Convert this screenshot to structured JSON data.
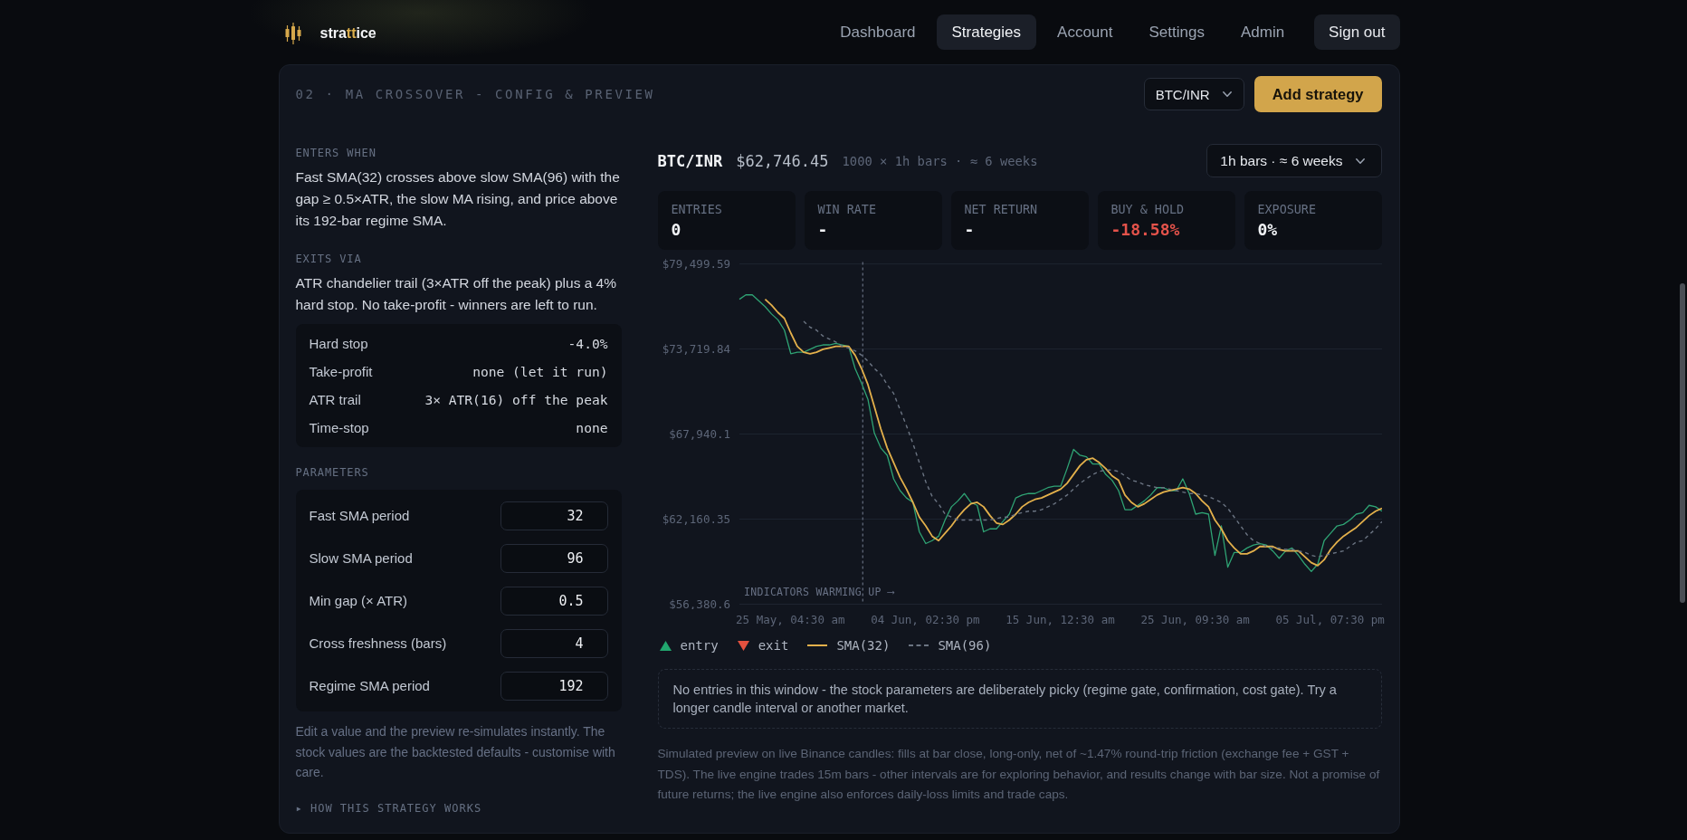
{
  "header": {
    "brand": [
      {
        "text": "stra",
        "accent": false
      },
      {
        "text": "tt",
        "accent": true
      },
      {
        "text": "ice",
        "accent": false
      }
    ],
    "nav": [
      {
        "label": "Dashboard",
        "selected": false
      },
      {
        "label": "Strategies",
        "selected": true
      },
      {
        "label": "Account",
        "selected": false
      },
      {
        "label": "Settings",
        "selected": false
      },
      {
        "label": "Admin",
        "selected": false
      }
    ],
    "sign_out": "Sign out"
  },
  "panel": {
    "title": "02 · MA CROSSOVER - CONFIG & PREVIEW",
    "market_select": {
      "value": "BTC/INR"
    },
    "add_button": "Add strategy"
  },
  "rules": [
    {
      "heading": "ENTERS WHEN",
      "text": "Fast SMA(32) crosses above slow SMA(96) with the gap ≥ 0.5×ATR, the slow MA rising, and price above its 192-bar regime SMA."
    },
    {
      "heading": "EXITS VIA",
      "text": "ATR chandelier trail (3×ATR off the peak) plus a 4% hard stop. No take-profit - winners are left to run."
    }
  ],
  "exit_settings": [
    {
      "label": "Hard stop",
      "value": "-4.0%"
    },
    {
      "label": "Take-profit",
      "value": "none (let it run)"
    },
    {
      "label": "ATR trail",
      "value": "3× ATR(16) off the peak"
    },
    {
      "label": "Time-stop",
      "value": "none"
    }
  ],
  "parameters": {
    "heading": "PARAMETERS",
    "fields": [
      {
        "label": "Fast SMA period",
        "value": "32"
      },
      {
        "label": "Slow SMA period",
        "value": "96"
      },
      {
        "label": "Min gap (× ATR)",
        "value": "0.5"
      },
      {
        "label": "Cross freshness (bars)",
        "value": "4"
      },
      {
        "label": "Regime SMA period",
        "value": "192"
      }
    ],
    "note": "Edit a value and the preview re-simulates instantly. The stock values are the backtested defaults - customise with care.",
    "details": "▸ HOW THIS STRATEGY WORKS"
  },
  "preview": {
    "symbol": "BTC/INR",
    "price": "$62,746.45",
    "range": "1000 × 1h bars · ≈ 6 weeks",
    "interval_select": {
      "value": "1h bars · ≈ 6 weeks"
    },
    "stats": [
      {
        "label": "ENTRIES",
        "value": "0",
        "negative": false
      },
      {
        "label": "WIN RATE",
        "value": "-",
        "negative": false
      },
      {
        "label": "NET RETURN",
        "value": "-",
        "negative": false
      },
      {
        "label": "BUY & HOLD",
        "value": "-18.58%",
        "negative": true
      },
      {
        "label": "EXPOSURE",
        "value": "0%",
        "negative": false
      }
    ],
    "chart_data": {
      "type": "line",
      "categories": [
        null,
        null,
        null,
        null,
        null,
        null,
        null,
        null,
        "25 May, 04:30 am",
        null,
        null,
        null,
        null,
        null,
        null,
        null,
        null,
        null,
        null,
        null,
        null,
        null,
        null,
        null,
        null,
        null,
        null,
        null,
        null,
        "04 Jun, 02:30 pm",
        null,
        null,
        null,
        null,
        null,
        null,
        null,
        null,
        null,
        null,
        null,
        null,
        null,
        null,
        null,
        null,
        null,
        null,
        null,
        null,
        "15 Jun, 12:30 am",
        null,
        null,
        null,
        null,
        null,
        null,
        null,
        null,
        null,
        null,
        null,
        null,
        null,
        null,
        null,
        null,
        null,
        null,
        null,
        null,
        "25 Jun, 09:30 am",
        null,
        null,
        null,
        null,
        null,
        null,
        null,
        null,
        null,
        null,
        null,
        null,
        null,
        null,
        null,
        null,
        null,
        null,
        null,
        null,
        "05 Jul, 07:30 pm",
        null,
        null,
        null,
        null,
        null,
        null,
        null,
        null
      ],
      "series": [
        {
          "color": "#2fa374",
          "values": [
            77100,
            77400,
            77400,
            77000,
            76600,
            76100,
            75700,
            75000,
            73400,
            73500,
            73500,
            73700,
            73900,
            74000,
            74000,
            74100,
            74000,
            73900,
            72400,
            71400,
            70300,
            68000,
            67000,
            66500,
            64900,
            64100,
            63600,
            63300,
            61300,
            60500,
            60700,
            61000,
            62100,
            63000,
            63400,
            63900,
            63300,
            63100,
            61300,
            61500,
            61500,
            62000,
            62500,
            63600,
            63800,
            63900,
            63900,
            64100,
            64300,
            64400,
            64400,
            65600,
            66900,
            66500,
            66400,
            65900,
            65900,
            65200,
            64800,
            64100,
            62800,
            62800,
            63100,
            63400,
            63800,
            64300,
            64300,
            64100,
            64100,
            64900,
            63900,
            62500,
            62600,
            62500,
            59700,
            61700,
            58900,
            59900,
            59900,
            60200,
            60400,
            60500,
            60400,
            60000,
            59500,
            60000,
            60200,
            59700,
            59100,
            58600,
            59100,
            60700,
            61200,
            61700,
            61800,
            62100,
            62500,
            62600,
            63100,
            63000,
            62700
          ]
        },
        {
          "name": "SMA(32)",
          "color": "#e3b04b",
          "line_style": "solid",
          "values": [
            null,
            null,
            null,
            null,
            77100,
            76700,
            76200,
            75800,
            74800,
            73900,
            73500,
            73400,
            73500,
            73700,
            73800,
            73900,
            73900,
            73900,
            73300,
            72400,
            71300,
            69800,
            68300,
            67000,
            66000,
            65000,
            64200,
            63300,
            62300,
            61700,
            61000,
            60700,
            61200,
            61700,
            62300,
            62800,
            63200,
            63300,
            63000,
            62400,
            61900,
            61800,
            62100,
            62500,
            63000,
            63300,
            63500,
            63600,
            63800,
            64000,
            64200,
            64600,
            65200,
            65800,
            66200,
            66300,
            66000,
            65600,
            65100,
            64800,
            63800,
            63300,
            63000,
            63200,
            63500,
            63800,
            64000,
            64100,
            64200,
            64300,
            64200,
            63900,
            63400,
            63000,
            62100,
            61500,
            60700,
            60200,
            59800,
            59800,
            60000,
            60300,
            60300,
            60300,
            60100,
            60000,
            60000,
            60000,
            59600,
            59200,
            59000,
            59400,
            60100,
            60600,
            61000,
            61300,
            61600,
            62000,
            62400,
            62700,
            62900
          ]
        },
        {
          "name": "SMA(96)",
          "color": "#6b7482",
          "line_style": "dashed",
          "values": [
            null,
            null,
            null,
            null,
            null,
            null,
            null,
            null,
            null,
            null,
            75600,
            75200,
            75000,
            74600,
            74400,
            74200,
            73900,
            73800,
            73600,
            73300,
            72900,
            72400,
            72000,
            71300,
            70700,
            69600,
            68500,
            67300,
            66000,
            64700,
            63700,
            63200,
            62500,
            62300,
            62100,
            62100,
            62100,
            62100,
            62100,
            62100,
            62200,
            62300,
            62300,
            62500,
            62600,
            62700,
            62700,
            62800,
            63000,
            63200,
            63500,
            63800,
            64200,
            64600,
            64900,
            65200,
            65400,
            65500,
            65500,
            65400,
            65100,
            64800,
            64700,
            64500,
            64400,
            64300,
            64300,
            64200,
            64100,
            64000,
            63900,
            63900,
            63800,
            63700,
            63500,
            63300,
            62900,
            62300,
            61700,
            61100,
            60700,
            60500,
            60300,
            60200,
            60200,
            60100,
            60100,
            60000,
            59900,
            59700,
            59600,
            59700,
            59800,
            59900,
            60000,
            60300,
            60600,
            60700,
            61100,
            61500,
            62000
          ]
        }
      ],
      "ylim": [
        56380.6,
        79499.59
      ],
      "yticks": [
        {
          "value": 79499.59,
          "label": "$79,499.59"
        },
        {
          "value": 73719.84,
          "label": "$73,719.84"
        },
        {
          "value": 67940.1,
          "label": "$67,940.1"
        },
        {
          "value": 62160.35,
          "label": "$62,160.35"
        },
        {
          "value": 56380.6,
          "label": "$56,380.6"
        }
      ],
      "grid": true,
      "annotations": [
        "INDICATORS WARMING UP ⟶"
      ]
    },
    "legend": [
      {
        "kind": "entry",
        "label": "entry",
        "color": "#21a66e"
      },
      {
        "kind": "exit",
        "label": "exit",
        "color": "#e4513f"
      }
    ],
    "notice": "No entries in this window - the stock parameters are deliberately picky (regime gate, confirmation, cost gate). Try a longer candle interval or another market.",
    "disclaimer": "Simulated preview on live Binance candles: fills at bar close, long-only, net of ~1.47% round-trip friction (exchange fee + GST + TDS). The live engine trades 15m bars - other intervals are for exploring behavior, and results change with bar size. Not a promise of future returns; the live engine also enforces daily-loss limits and trade caps."
  }
}
